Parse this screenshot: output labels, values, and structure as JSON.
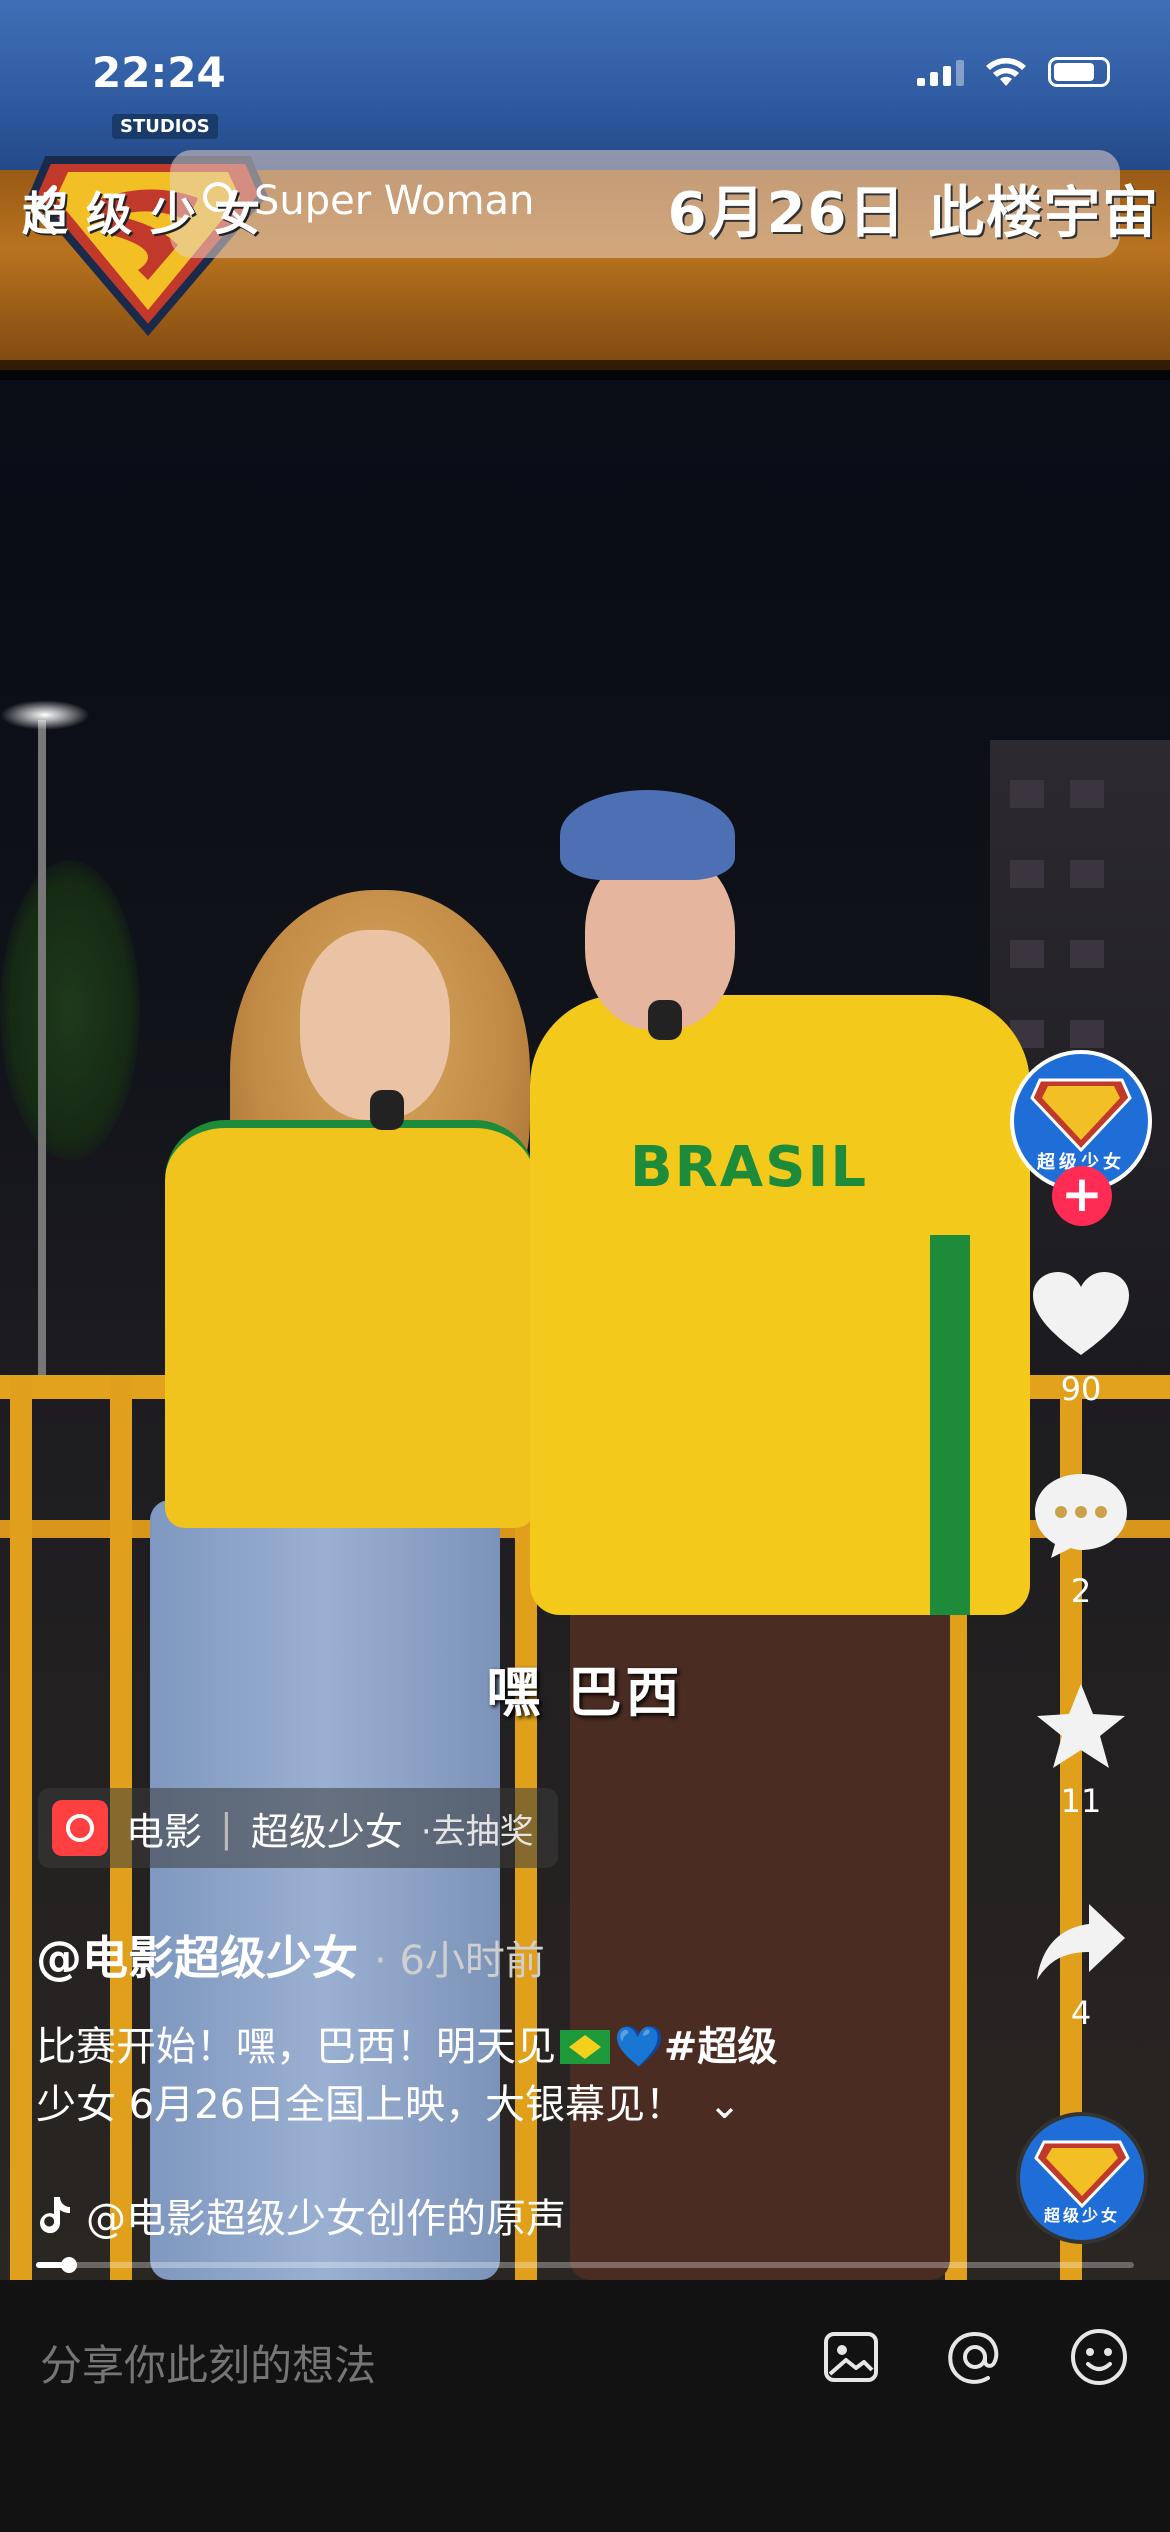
{
  "status_bar": {
    "time": "22:24"
  },
  "overlay": {
    "studio_tag": "STUDIOS",
    "movie_title": "超级少女",
    "search_text": "Super Woman",
    "release_banner": "6月26日 此楼宇宙"
  },
  "video": {
    "subtitle": "嘿 巴西",
    "shirt_text": "BRASIL"
  },
  "actions": {
    "avatar_label": "超级少女",
    "likes": "90",
    "comments": "2",
    "favorites": "11",
    "shares": "4"
  },
  "anchor": {
    "category": "电影",
    "title": "超级少女",
    "cta": "·去抽奖"
  },
  "post": {
    "author": "@电影超级少女",
    "time": "· 6小时前",
    "desc_part1": "比赛开始！嘿，巴西！明天见",
    "desc_heart": "💙",
    "desc_hashtag": "#超级",
    "desc_line2": "少女 6月26日全国上映，大银幕见！",
    "expand": "⌄",
    "music": "@电影超级少女创作的原声",
    "progress_percent": 3
  },
  "bottom_bar": {
    "placeholder": "分享你此刻的想法"
  },
  "colors": {
    "accent_red": "#fe2c55",
    "brand_blue": "#1f6ed8",
    "heart_blue": "#2f8cff"
  }
}
